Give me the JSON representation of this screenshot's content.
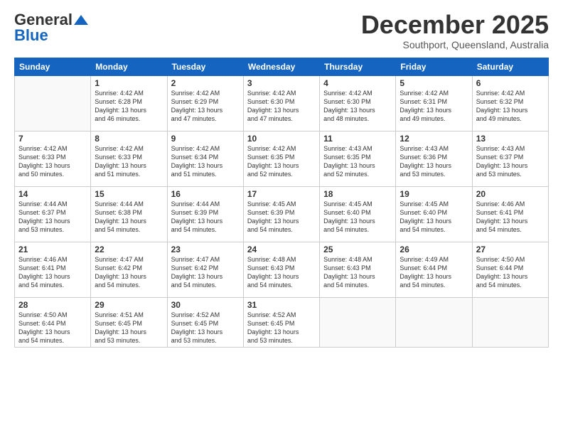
{
  "header": {
    "logo_general": "General",
    "logo_blue": "Blue",
    "month": "December 2025",
    "location": "Southport, Queensland, Australia"
  },
  "weekdays": [
    "Sunday",
    "Monday",
    "Tuesday",
    "Wednesday",
    "Thursday",
    "Friday",
    "Saturday"
  ],
  "weeks": [
    [
      {
        "day": "",
        "info": ""
      },
      {
        "day": "1",
        "info": "Sunrise: 4:42 AM\nSunset: 6:28 PM\nDaylight: 13 hours\nand 46 minutes."
      },
      {
        "day": "2",
        "info": "Sunrise: 4:42 AM\nSunset: 6:29 PM\nDaylight: 13 hours\nand 47 minutes."
      },
      {
        "day": "3",
        "info": "Sunrise: 4:42 AM\nSunset: 6:30 PM\nDaylight: 13 hours\nand 47 minutes."
      },
      {
        "day": "4",
        "info": "Sunrise: 4:42 AM\nSunset: 6:30 PM\nDaylight: 13 hours\nand 48 minutes."
      },
      {
        "day": "5",
        "info": "Sunrise: 4:42 AM\nSunset: 6:31 PM\nDaylight: 13 hours\nand 49 minutes."
      },
      {
        "day": "6",
        "info": "Sunrise: 4:42 AM\nSunset: 6:32 PM\nDaylight: 13 hours\nand 49 minutes."
      }
    ],
    [
      {
        "day": "7",
        "info": "Sunrise: 4:42 AM\nSunset: 6:33 PM\nDaylight: 13 hours\nand 50 minutes."
      },
      {
        "day": "8",
        "info": "Sunrise: 4:42 AM\nSunset: 6:33 PM\nDaylight: 13 hours\nand 51 minutes."
      },
      {
        "day": "9",
        "info": "Sunrise: 4:42 AM\nSunset: 6:34 PM\nDaylight: 13 hours\nand 51 minutes."
      },
      {
        "day": "10",
        "info": "Sunrise: 4:42 AM\nSunset: 6:35 PM\nDaylight: 13 hours\nand 52 minutes."
      },
      {
        "day": "11",
        "info": "Sunrise: 4:43 AM\nSunset: 6:35 PM\nDaylight: 13 hours\nand 52 minutes."
      },
      {
        "day": "12",
        "info": "Sunrise: 4:43 AM\nSunset: 6:36 PM\nDaylight: 13 hours\nand 53 minutes."
      },
      {
        "day": "13",
        "info": "Sunrise: 4:43 AM\nSunset: 6:37 PM\nDaylight: 13 hours\nand 53 minutes."
      }
    ],
    [
      {
        "day": "14",
        "info": "Sunrise: 4:44 AM\nSunset: 6:37 PM\nDaylight: 13 hours\nand 53 minutes."
      },
      {
        "day": "15",
        "info": "Sunrise: 4:44 AM\nSunset: 6:38 PM\nDaylight: 13 hours\nand 54 minutes."
      },
      {
        "day": "16",
        "info": "Sunrise: 4:44 AM\nSunset: 6:39 PM\nDaylight: 13 hours\nand 54 minutes."
      },
      {
        "day": "17",
        "info": "Sunrise: 4:45 AM\nSunset: 6:39 PM\nDaylight: 13 hours\nand 54 minutes."
      },
      {
        "day": "18",
        "info": "Sunrise: 4:45 AM\nSunset: 6:40 PM\nDaylight: 13 hours\nand 54 minutes."
      },
      {
        "day": "19",
        "info": "Sunrise: 4:45 AM\nSunset: 6:40 PM\nDaylight: 13 hours\nand 54 minutes."
      },
      {
        "day": "20",
        "info": "Sunrise: 4:46 AM\nSunset: 6:41 PM\nDaylight: 13 hours\nand 54 minutes."
      }
    ],
    [
      {
        "day": "21",
        "info": "Sunrise: 4:46 AM\nSunset: 6:41 PM\nDaylight: 13 hours\nand 54 minutes."
      },
      {
        "day": "22",
        "info": "Sunrise: 4:47 AM\nSunset: 6:42 PM\nDaylight: 13 hours\nand 54 minutes."
      },
      {
        "day": "23",
        "info": "Sunrise: 4:47 AM\nSunset: 6:42 PM\nDaylight: 13 hours\nand 54 minutes."
      },
      {
        "day": "24",
        "info": "Sunrise: 4:48 AM\nSunset: 6:43 PM\nDaylight: 13 hours\nand 54 minutes."
      },
      {
        "day": "25",
        "info": "Sunrise: 4:48 AM\nSunset: 6:43 PM\nDaylight: 13 hours\nand 54 minutes."
      },
      {
        "day": "26",
        "info": "Sunrise: 4:49 AM\nSunset: 6:44 PM\nDaylight: 13 hours\nand 54 minutes."
      },
      {
        "day": "27",
        "info": "Sunrise: 4:50 AM\nSunset: 6:44 PM\nDaylight: 13 hours\nand 54 minutes."
      }
    ],
    [
      {
        "day": "28",
        "info": "Sunrise: 4:50 AM\nSunset: 6:44 PM\nDaylight: 13 hours\nand 54 minutes."
      },
      {
        "day": "29",
        "info": "Sunrise: 4:51 AM\nSunset: 6:45 PM\nDaylight: 13 hours\nand 53 minutes."
      },
      {
        "day": "30",
        "info": "Sunrise: 4:52 AM\nSunset: 6:45 PM\nDaylight: 13 hours\nand 53 minutes."
      },
      {
        "day": "31",
        "info": "Sunrise: 4:52 AM\nSunset: 6:45 PM\nDaylight: 13 hours\nand 53 minutes."
      },
      {
        "day": "",
        "info": ""
      },
      {
        "day": "",
        "info": ""
      },
      {
        "day": "",
        "info": ""
      }
    ]
  ]
}
